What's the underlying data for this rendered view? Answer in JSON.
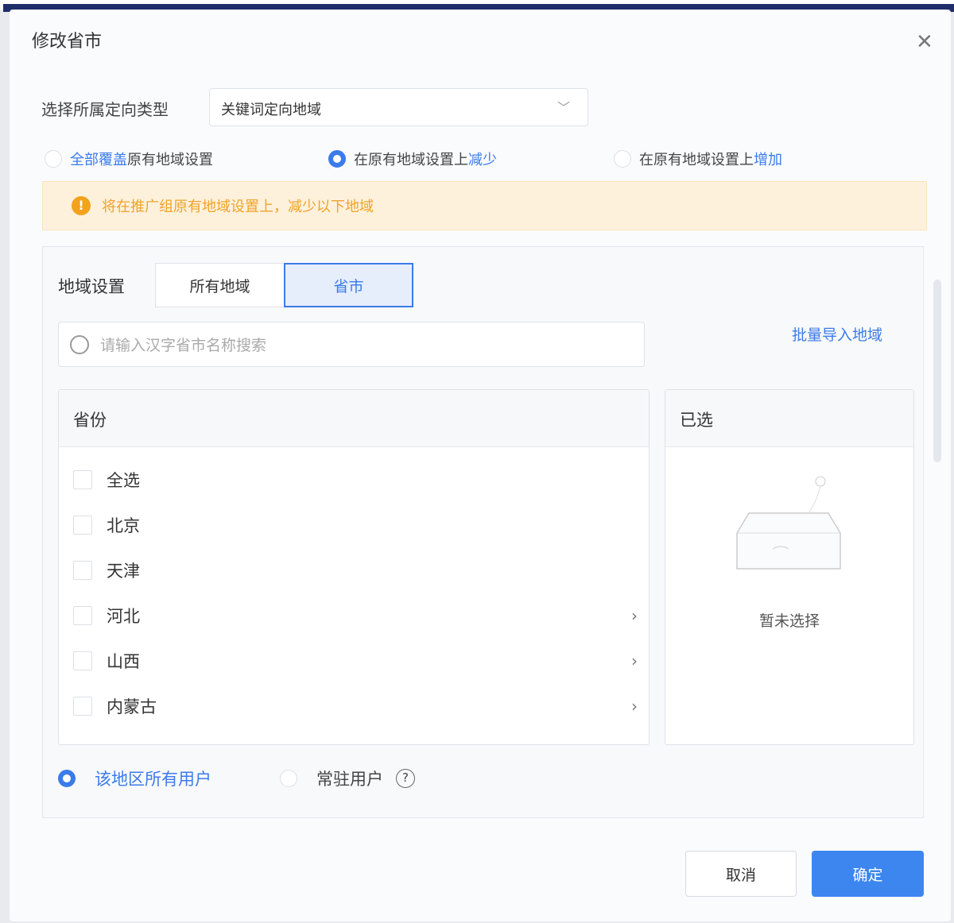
{
  "dialog": {
    "title": "修改省市"
  },
  "target_type": {
    "label": "选择所属定向类型",
    "value": "关键词定向地域"
  },
  "modes": [
    {
      "prefix": "",
      "highlight": "全部覆盖",
      "suffix": "原有地域设置",
      "selected": false
    },
    {
      "prefix": "在原有地域设置上",
      "highlight": "减少",
      "suffix": "",
      "selected": true
    },
    {
      "prefix": "在原有地域设置上",
      "highlight": "增加",
      "suffix": "",
      "selected": false
    }
  ],
  "warning": "将在推广组原有地域设置上，减少以下地域",
  "region": {
    "label": "地域设置",
    "tabs": [
      "所有地域",
      "省市"
    ],
    "active_tab": "省市",
    "search_placeholder": "请输入汉字省市名称搜索",
    "batch_import": "批量导入地域"
  },
  "provinces": {
    "header": "省份",
    "items": [
      {
        "name": "全选",
        "expandable": false
      },
      {
        "name": "北京",
        "expandable": false
      },
      {
        "name": "天津",
        "expandable": false
      },
      {
        "name": "河北",
        "expandable": true
      },
      {
        "name": "山西",
        "expandable": true
      },
      {
        "name": "内蒙古",
        "expandable": true
      }
    ]
  },
  "selected": {
    "header": "已选",
    "empty": "暂未选择"
  },
  "users": [
    {
      "label": "该地区所有用户",
      "selected": true
    },
    {
      "label": "常驻用户",
      "selected": false
    }
  ],
  "buttons": {
    "cancel": "取消",
    "confirm": "确定"
  }
}
